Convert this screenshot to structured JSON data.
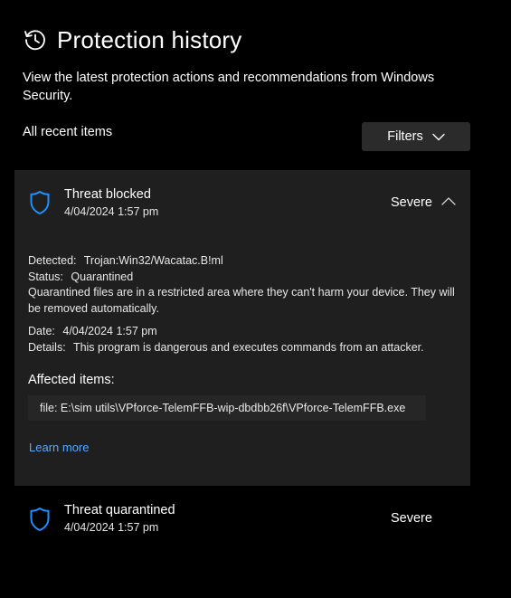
{
  "header": {
    "title": "Protection history",
    "icon": "history-icon"
  },
  "description": "View the latest protection actions and recommendations from Windows Security.",
  "section_label": "All recent items",
  "filters": {
    "label": "Filters",
    "icon": "chevron-down-icon"
  },
  "colors": {
    "background": "#000000",
    "card_background": "#1f1f1f",
    "button_background": "#2b2b2b",
    "accent_shield": "#1e90ff",
    "link": "#5aa9ff"
  },
  "items": [
    {
      "title": "Threat blocked",
      "date": "4/04/2024 1:57 pm",
      "severity": "Severe",
      "expanded": true,
      "icon": "shield-icon",
      "details": {
        "detected_label": "Detected:",
        "detected_value": "Trojan:Win32/Wacatac.B!ml",
        "status_label": "Status:",
        "status_value": "Quarantined",
        "status_note": "Quarantined files are in a restricted area where they can't harm your device. They will be removed automatically.",
        "date_label": "Date:",
        "date_value": "4/04/2024 1:57 pm",
        "details_label": "Details:",
        "details_value": "This program is dangerous and executes commands from an attacker.",
        "affected_heading": "Affected items:",
        "affected_item": "file: E:\\sim utils\\VPforce-TelemFFB-wip-dbdbb26f\\VPforce-TelemFFB.exe",
        "learn_more": "Learn more"
      }
    },
    {
      "title": "Threat quarantined",
      "date": "4/04/2024 1:57 pm",
      "severity": "Severe",
      "expanded": false,
      "icon": "shield-icon"
    }
  ]
}
